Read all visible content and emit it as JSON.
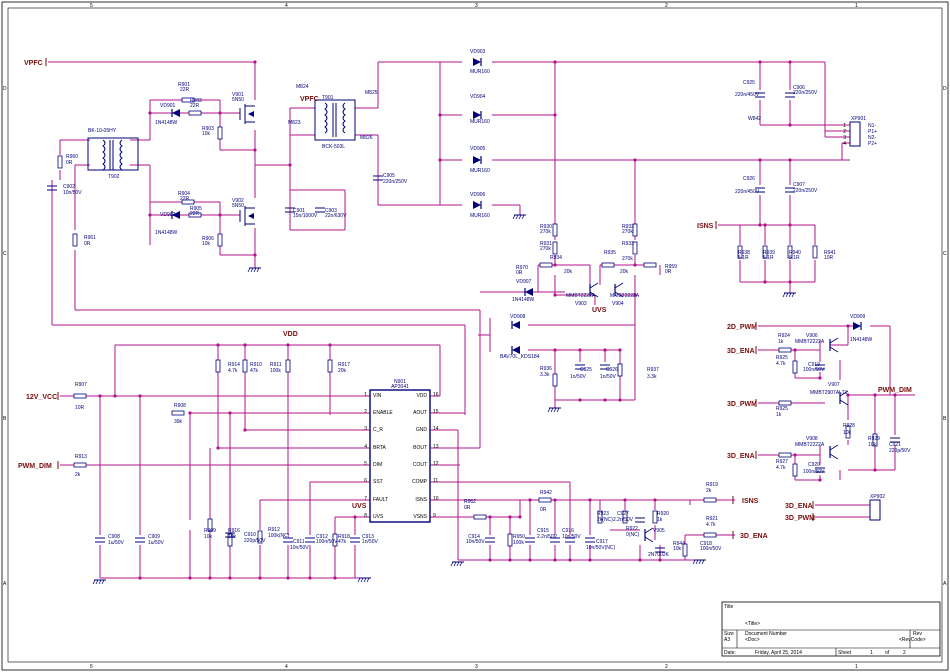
{
  "frame": {
    "top_markers": [
      "5",
      "4",
      "3",
      "2",
      "1"
    ],
    "side_markers": [
      "D",
      "C",
      "B",
      "A"
    ]
  },
  "nets": {
    "vpfc": "VPFC",
    "vpfc_inner": "VPFC",
    "twelve_v": "12V_VCC",
    "pwm_dim": "PWM_DIM",
    "vdd": "VDD",
    "uvs": "UVS",
    "uvs2": "UVS",
    "isns_left": "ISNS",
    "isns_right": "ISNS",
    "ena_3d_out": "3D_ENA",
    "pwm_2d": "2D_PWM",
    "ena_3d_a": "3D_ENA",
    "pwm_3d_a": "3D_PWM",
    "ena_3d_b": "3D_ENA",
    "pwm_dim_right": "PWM_DIM",
    "ena_3d_c": "3D_ENA",
    "pwm_3d_c": "3D_PWM"
  },
  "ic": {
    "ref": "N901",
    "part": "AP3041",
    "left_pins": [
      {
        "num": "1",
        "name": "VIN"
      },
      {
        "num": "2",
        "name": "ENABLE"
      },
      {
        "num": "3",
        "name": "C_R"
      },
      {
        "num": "4",
        "name": "BRTA"
      },
      {
        "num": "5",
        "name": "DIM"
      },
      {
        "num": "6",
        "name": "SST"
      },
      {
        "num": "7",
        "name": "FAULT"
      },
      {
        "num": "8",
        "name": "UVS"
      }
    ],
    "right_pins": [
      {
        "num": "16",
        "name": "VDD"
      },
      {
        "num": "15",
        "name": "AOUT"
      },
      {
        "num": "14",
        "name": "GND"
      },
      {
        "num": "13",
        "name": "BOUT"
      },
      {
        "num": "12",
        "name": "COUT"
      },
      {
        "num": "11",
        "name": "COMP"
      },
      {
        "num": "10",
        "name": "ISNS"
      },
      {
        "num": "9",
        "name": "VSNS"
      }
    ]
  },
  "transformers": [
    {
      "ref": "T902",
      "part": "BK-10-05HY"
    },
    {
      "ref": "T901",
      "part": "BCK-503L"
    }
  ],
  "connectors": {
    "xp901": {
      "ref": "XP901",
      "pins": [
        "1",
        "2",
        "3",
        "4"
      ],
      "labels": [
        "N1-",
        "P1+",
        "N2-",
        "P2+"
      ]
    },
    "xp902": {
      "ref": "XP902"
    }
  },
  "labels": [
    {
      "id": "R901",
      "text": "R901"
    },
    {
      "id": "R901v",
      "text": "22R"
    },
    {
      "id": "VD901",
      "text": "VD901"
    },
    {
      "id": "VD901p",
      "text": "1N4148W"
    },
    {
      "id": "R902",
      "text": "R902"
    },
    {
      "id": "R902v",
      "text": "22R"
    },
    {
      "id": "R903",
      "text": "R903"
    },
    {
      "id": "R903v",
      "text": "10k"
    },
    {
      "id": "V901",
      "text": "V901"
    },
    {
      "id": "V901p",
      "text": "5N50"
    },
    {
      "id": "R904",
      "text": "R904"
    },
    {
      "id": "R904v",
      "text": "22R"
    },
    {
      "id": "VD902",
      "text": "VD902"
    },
    {
      "id": "VD902p",
      "text": "1N4148W"
    },
    {
      "id": "R905",
      "text": "R905"
    },
    {
      "id": "R905v",
      "text": "22R"
    },
    {
      "id": "R906",
      "text": "R906"
    },
    {
      "id": "R906v",
      "text": "10k"
    },
    {
      "id": "V902",
      "text": "V902"
    },
    {
      "id": "V902p",
      "text": "5N50"
    },
    {
      "id": "R960",
      "text": "R960"
    },
    {
      "id": "R960v",
      "text": "0R"
    },
    {
      "id": "C902",
      "text": "C902"
    },
    {
      "id": "C902v",
      "text": "10n/50V"
    },
    {
      "id": "R961",
      "text": "R961"
    },
    {
      "id": "R961v",
      "text": "0R"
    },
    {
      "id": "M824",
      "text": "M824"
    },
    {
      "id": "M823",
      "text": "M823"
    },
    {
      "id": "M825",
      "text": "M825"
    },
    {
      "id": "M826",
      "text": "M826"
    },
    {
      "id": "C901",
      "text": "C901"
    },
    {
      "id": "C901v",
      "text": "15n/1000V"
    },
    {
      "id": "C903",
      "text": "C903"
    },
    {
      "id": "C903v",
      "text": "22n/630V"
    },
    {
      "id": "C905",
      "text": "C905"
    },
    {
      "id": "C905v",
      "text": "220n/250V"
    },
    {
      "id": "VD903",
      "text": "VD903"
    },
    {
      "id": "VD903p",
      "text": "MUR160"
    },
    {
      "id": "VD904",
      "text": "VD904"
    },
    {
      "id": "VD904p",
      "text": "MUR160"
    },
    {
      "id": "VD905",
      "text": "VD905"
    },
    {
      "id": "VD905p",
      "text": "MUR160"
    },
    {
      "id": "VD906",
      "text": "VD906"
    },
    {
      "id": "VD906p",
      "text": "MUR160"
    },
    {
      "id": "C925",
      "text": "C925"
    },
    {
      "id": "C925v",
      "text": "220n/450V"
    },
    {
      "id": "C906",
      "text": "C906"
    },
    {
      "id": "C906v",
      "text": "220n/250V"
    },
    {
      "id": "W842",
      "text": "W842"
    },
    {
      "id": "C926",
      "text": "C926"
    },
    {
      "id": "C926v",
      "text": "220n/450V"
    },
    {
      "id": "C907",
      "text": "C907"
    },
    {
      "id": "C907v",
      "text": "220n/250V"
    },
    {
      "id": "R938",
      "text": "R938"
    },
    {
      "id": "R938v",
      "text": "5.1R"
    },
    {
      "id": "R939",
      "text": "R939"
    },
    {
      "id": "R939v",
      "text": "5.1R"
    },
    {
      "id": "R940",
      "text": "R940"
    },
    {
      "id": "R940v",
      "text": "5.1R"
    },
    {
      "id": "R941",
      "text": "R941"
    },
    {
      "id": "R941v",
      "text": "10R"
    },
    {
      "id": "R930",
      "text": "R930"
    },
    {
      "id": "R930v",
      "text": "270k"
    },
    {
      "id": "R931",
      "text": "R931"
    },
    {
      "id": "R931v",
      "text": "270k"
    },
    {
      "id": "R934",
      "text": "R934"
    },
    {
      "id": "R934v",
      "text": "20k"
    },
    {
      "id": "R935",
      "text": "R935"
    },
    {
      "id": "R932",
      "text": "R932"
    },
    {
      "id": "R932v",
      "text": "270k"
    },
    {
      "id": "R933",
      "text": "R933"
    },
    {
      "id": "R933v",
      "text": "270k"
    },
    {
      "id": "R935v",
      "text": "20k"
    },
    {
      "id": "R970",
      "text": "R970"
    },
    {
      "id": "R970v",
      "text": "0R"
    },
    {
      "id": "R959",
      "text": "R959"
    },
    {
      "id": "R959v",
      "text": "0R"
    },
    {
      "id": "VD907",
      "text": "VD907"
    },
    {
      "id": "VD907p",
      "text": "1N4148W"
    },
    {
      "id": "V903p",
      "text": "MMBT2222A"
    },
    {
      "id": "V903",
      "text": "V903"
    },
    {
      "id": "V904p",
      "text": "MMBT2222A"
    },
    {
      "id": "V904",
      "text": "V904"
    },
    {
      "id": "VD908",
      "text": "VD908"
    },
    {
      "id": "VD908p",
      "text": "BAV70L_KDS184"
    },
    {
      "id": "R936",
      "text": "R936"
    },
    {
      "id": "R936v",
      "text": "3.3k"
    },
    {
      "id": "C925b",
      "text": "C925"
    },
    {
      "id": "C925bv",
      "text": "1n/50V"
    },
    {
      "id": "C926b",
      "text": "C926"
    },
    {
      "id": "C926bv",
      "text": "1n/50V"
    },
    {
      "id": "R937",
      "text": "R937"
    },
    {
      "id": "R937v",
      "text": "3.3k"
    },
    {
      "id": "R907",
      "text": "R907"
    },
    {
      "id": "R907v",
      "text": "10R"
    },
    {
      "id": "R908",
      "text": "R908"
    },
    {
      "id": "R908v",
      "text": "39k"
    },
    {
      "id": "R913",
      "text": "R913"
    },
    {
      "id": "R913v",
      "text": "2k"
    },
    {
      "id": "R914",
      "text": "R914"
    },
    {
      "id": "R914v",
      "text": "4.7k"
    },
    {
      "id": "R910",
      "text": "R910"
    },
    {
      "id": "R910v",
      "text": "47k"
    },
    {
      "id": "R911",
      "text": "R911"
    },
    {
      "id": "R911v",
      "text": "100k"
    },
    {
      "id": "R917",
      "text": "R917"
    },
    {
      "id": "R917v",
      "text": "20k"
    },
    {
      "id": "C908",
      "text": "C908"
    },
    {
      "id": "C908v",
      "text": "1u/50V"
    },
    {
      "id": "C909",
      "text": "C909"
    },
    {
      "id": "C909v",
      "text": "1u/50V"
    },
    {
      "id": "R909",
      "text": "R909"
    },
    {
      "id": "R909v",
      "text": "10k"
    },
    {
      "id": "R916",
      "text": "R916"
    },
    {
      "id": "R916v",
      "text": "10k"
    },
    {
      "id": "C910",
      "text": "C910"
    },
    {
      "id": "C910v",
      "text": "220p/50V"
    },
    {
      "id": "R912",
      "text": "R912"
    },
    {
      "id": "R912v",
      "text": "100k(NC)"
    },
    {
      "id": "C911",
      "text": "C911"
    },
    {
      "id": "C911v",
      "text": "10n/50V"
    },
    {
      "id": "C912",
      "text": "C912"
    },
    {
      "id": "C912v",
      "text": "100n/50V"
    },
    {
      "id": "R918",
      "text": "R918"
    },
    {
      "id": "R918v",
      "text": "47k"
    },
    {
      "id": "C913",
      "text": "C913"
    },
    {
      "id": "C913v",
      "text": "1n/50V"
    },
    {
      "id": "R962",
      "text": "R962"
    },
    {
      "id": "R962v",
      "text": "0R"
    },
    {
      "id": "C914",
      "text": "C914"
    },
    {
      "id": "C914v",
      "text": "10n/50V"
    },
    {
      "id": "R950",
      "text": "R950"
    },
    {
      "id": "R950v",
      "text": "100k"
    },
    {
      "id": "R942",
      "text": "R942"
    },
    {
      "id": "R942v",
      "text": "0R"
    },
    {
      "id": "C915",
      "text": "C915"
    },
    {
      "id": "C915v",
      "text": "2.2n/50V"
    },
    {
      "id": "C916",
      "text": "C916"
    },
    {
      "id": "C916v",
      "text": "10n/50V"
    },
    {
      "id": "C917",
      "text": "C917"
    },
    {
      "id": "C917v",
      "text": "10n/50V(NC)"
    },
    {
      "id": "R923",
      "text": "R923"
    },
    {
      "id": "R923v",
      "text": "2k(NC)"
    },
    {
      "id": "C927",
      "text": "C927"
    },
    {
      "id": "C927v",
      "text": "2.2n/50V"
    },
    {
      "id": "R920",
      "text": "R920"
    },
    {
      "id": "R920v",
      "text": "1k"
    },
    {
      "id": "R922",
      "text": "R922"
    },
    {
      "id": "R922v",
      "text": "0(NC)"
    },
    {
      "id": "V905",
      "text": "V905"
    },
    {
      "id": "V905p",
      "text": "2N7002K"
    },
    {
      "id": "R944",
      "text": "R944"
    },
    {
      "id": "R944v",
      "text": "10k"
    },
    {
      "id": "C918",
      "text": "C918"
    },
    {
      "id": "C918v",
      "text": "100n/50V"
    },
    {
      "id": "R919",
      "text": "R919"
    },
    {
      "id": "R919v",
      "text": "2k"
    },
    {
      "id": "R921",
      "text": "R921"
    },
    {
      "id": "R921v",
      "text": "4.7k"
    },
    {
      "id": "R924",
      "text": "R924"
    },
    {
      "id": "R924v",
      "text": "1k"
    },
    {
      "id": "V906a",
      "text": "V906"
    },
    {
      "id": "V906ap",
      "text": "MMBT2222A"
    },
    {
      "id": "R925a",
      "text": "R925"
    },
    {
      "id": "R925av",
      "text": "4.7k"
    },
    {
      "id": "C919",
      "text": "C919"
    },
    {
      "id": "C919v",
      "text": "100n/50V"
    },
    {
      "id": "VD909",
      "text": "VD909"
    },
    {
      "id": "VD909p",
      "text": "1N4148W"
    },
    {
      "id": "V907",
      "text": "V907"
    },
    {
      "id": "V907p",
      "text": "MMBT2907ALT1"
    },
    {
      "id": "R925b",
      "text": "R925"
    },
    {
      "id": "R925bv",
      "text": "1k"
    },
    {
      "id": "R928",
      "text": "R928"
    },
    {
      "id": "R928v",
      "text": "10k"
    },
    {
      "id": "R929",
      "text": "R929"
    },
    {
      "id": "R929v",
      "text": "10k"
    },
    {
      "id": "C921",
      "text": "C921"
    },
    {
      "id": "C921v",
      "text": "220p/50V"
    },
    {
      "id": "V908",
      "text": "V908"
    },
    {
      "id": "V908p",
      "text": "MMBT2222A"
    },
    {
      "id": "R927",
      "text": "R927"
    },
    {
      "id": "R927v",
      "text": "4.7k"
    },
    {
      "id": "C920",
      "text": "C920"
    },
    {
      "id": "C920v",
      "text": "100n/50V"
    }
  ],
  "title_block": {
    "title_label": "Title",
    "title_value": "<Title>",
    "size_label": "Size",
    "size_value": "A3",
    "docnum_label": "Document Number",
    "docnum_value": "<Doc>",
    "rev_label": "Rev",
    "rev_value": "<RevCode>",
    "date_label": "Date:",
    "date_value": "Friday, April 25, 2014",
    "sheet_label": "Sheet",
    "sheet_num": "1",
    "sheet_of": "of",
    "sheet_total": "2"
  }
}
